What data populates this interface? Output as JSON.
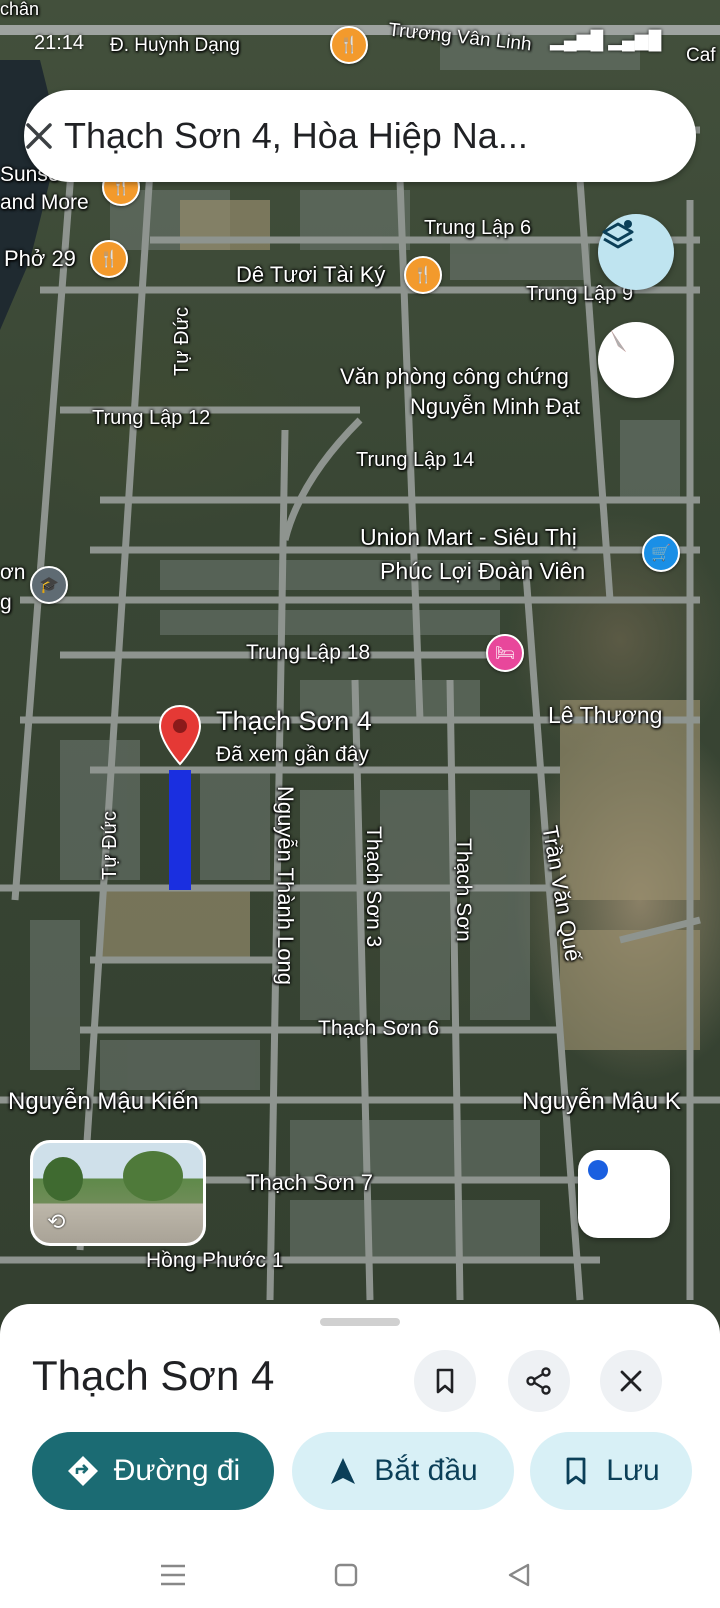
{
  "status": {
    "time": "21:14"
  },
  "search": {
    "query": "Thạch Sơn 4, Hòa Hiệp Na...",
    "close_icon": "close-icon"
  },
  "map_labels": {
    "d_huynh_dang": "Đ. Huỳnh Dạng",
    "truong_van_linh": "Trương Vân Linh",
    "top_left": "chân",
    "cafe": "Caf",
    "sunset_line1": "Sunse",
    "sunset_line2": "and More",
    "pho29": "Phở 29",
    "de_tuoi": "Dê Tươi Tài Ký",
    "trung_lap_6": "Trung Lập 6",
    "trung_lap_9": "Trung Lập 9",
    "tu_duc_top": "Tự Đức",
    "van_phong_line1": "Văn phòng công chứng",
    "van_phong_line2": "Nguyễn Minh Đạt",
    "trung_lap_12": "Trung Lập 12",
    "trung_lap_14": "Trung Lập 14",
    "union_line1": "Union Mart - Siêu Thị",
    "union_line2": "Phúc Lợi Đoàn Viên",
    "school_left1": "ơn",
    "school_left2": "g",
    "trung_lap_18": "Trung Lập 18",
    "le_thuong": "Lê Thương",
    "thach_son_4_pin": "Thạch Sơn 4",
    "recent": "Đã xem gần đây",
    "tu_duc_bottom": "Tự Đức",
    "nguyen_thanh_long": "Nguyễn Thành Long",
    "thach_son_3": "Thạch Sơn 3",
    "thach_son": "Thạch Sơn",
    "tran_van_que": "Trần Văn Quế",
    "thach_son_6": "Thạch Sơn 6",
    "nguyen_mau_kien_left": "Nguyễn Mậu Kiến",
    "nguyen_mau_kien_right": "Nguyễn Mậu K",
    "thach_son_7": "Thạch Sơn 7",
    "hong_phuoc_1": "Hồng Phước 1"
  },
  "sheet": {
    "title": "Thạch Sơn 4",
    "btn_directions": "Đường đi",
    "btn_start": "Bắt đầu",
    "btn_save": "Lưu"
  },
  "colors": {
    "teal": "#1b6b73",
    "pill_light": "#d8f0f6",
    "route": "#1a2fe0",
    "pin": "#e53935"
  }
}
